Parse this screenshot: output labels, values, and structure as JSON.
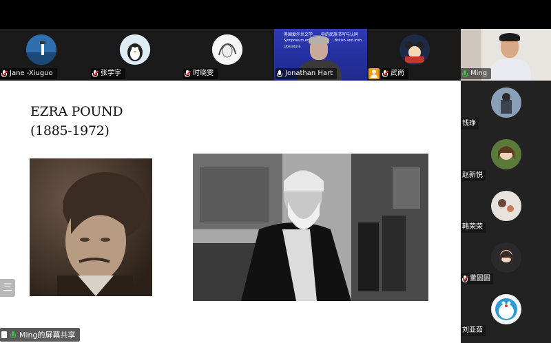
{
  "participants": [
    {
      "name": "Jane -Xiuguo",
      "mic": "muted"
    },
    {
      "name": "张学宇",
      "mic": "muted"
    },
    {
      "name": "时晓雯",
      "mic": "muted"
    },
    {
      "name": "Jonathan Hart",
      "mic": "on"
    },
    {
      "name": "武尚",
      "mic": "muted"
    }
  ],
  "video_banner": {
    "line1": "英国爱尔兰文学……中的民族书写与认同",
    "line2": "Symposium on Narrating…… British and Irish Literature"
  },
  "side_panel": {
    "active_speaker": "Ming",
    "items": [
      {
        "name": "钱琤"
      },
      {
        "name": "赵新悦"
      },
      {
        "name": "韩荣荣"
      },
      {
        "name": "董圆圆"
      },
      {
        "name": "刘亚茹"
      }
    ]
  },
  "slide": {
    "title_line1": "EZRA POUND",
    "title_line2": "(1885-1972)"
  },
  "side_button_label": "三",
  "share_label": "Ming的屏幕共享",
  "colors": {
    "background": "#000000",
    "strip": "#1a1a1a",
    "mic_active": "#3cc24b",
    "mic_muted": "#e53935",
    "host_badge": "#f39c12"
  }
}
